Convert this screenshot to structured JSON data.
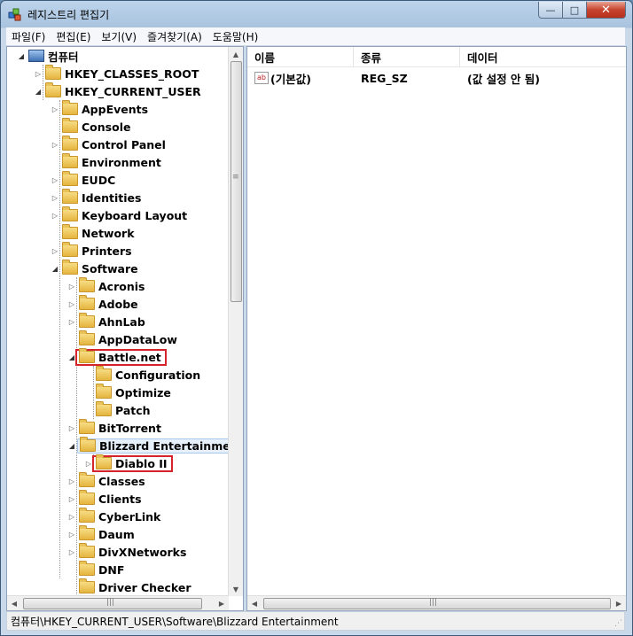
{
  "window": {
    "title": "레지스트리 편집기",
    "min_label": "—",
    "max_label": "□",
    "close_label": "✕"
  },
  "menu": [
    "파일(F)",
    "편집(E)",
    "보기(V)",
    "즐겨찾기(A)",
    "도움말(H)"
  ],
  "tree": {
    "root": "컴퓨터",
    "hkcr": "HKEY_CLASSES_ROOT",
    "hkcu": "HKEY_CURRENT_USER",
    "hkcu_children": [
      "AppEvents",
      "Console",
      "Control Panel",
      "Environment",
      "EUDC",
      "Identities",
      "Keyboard Layout",
      "Network",
      "Printers",
      "Software"
    ],
    "software_children": [
      "Acronis",
      "Adobe",
      "AhnLab",
      "AppDataLow",
      "Battle.net"
    ],
    "battlenet_children": [
      "Configuration",
      "Optimize",
      "Patch"
    ],
    "software_children_2": [
      "BitTorrent",
      "Blizzard Entertainment"
    ],
    "blizzard_children": [
      "Diablo II"
    ],
    "software_children_3": [
      "Classes",
      "Clients",
      "CyberLink",
      "Daum",
      "DivXNetworks",
      "DNF",
      "Driver Checker"
    ]
  },
  "columns": {
    "name": "이름",
    "type": "종류",
    "data": "데이터"
  },
  "values": [
    {
      "name": "(기본값)",
      "type": "REG_SZ",
      "data": "(값 설정 안 됨)",
      "icon": "ab"
    }
  ],
  "status": "컴퓨터\\HKEY_CURRENT_USER\\Software\\Blizzard Entertainment",
  "colors": {
    "highlight_box": "#d4232a",
    "selection": "#e6f0fb"
  }
}
